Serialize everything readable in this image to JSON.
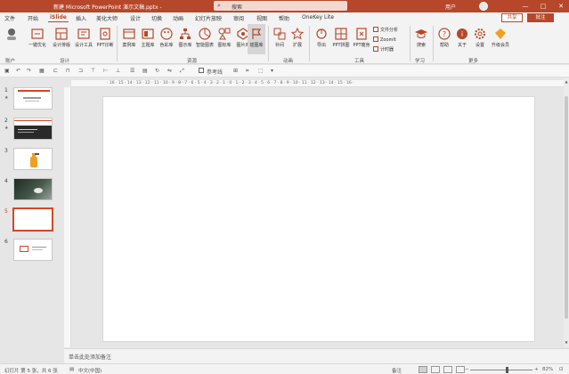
{
  "titlebar": {
    "title": "新建 Microsoft PowerPoint 演示文稿.pptx  -",
    "search_placeholder": "搜索",
    "user": "用户",
    "min": "—",
    "max": "□",
    "close": "✕"
  },
  "tabs": [
    "文件",
    "开始",
    "iSlide",
    "插入",
    "美化大师",
    "设计",
    "切换",
    "动画",
    "幻灯片放映",
    "审阅",
    "视图",
    "帮助",
    "OneKey Lite"
  ],
  "share": "共享",
  "comment": "批注",
  "ribbon": {
    "account": "账户",
    "one_key": "一键优化",
    "design_lib": "设计排版",
    "design_tools": "设计工具",
    "ppt_diag": "PPT诊断",
    "theme": "案例库",
    "color": "主题库",
    "color2": "色彩库",
    "icon": "图示库",
    "smart": "智能图表",
    "iconlib": "图标库",
    "pic": "图片库",
    "illus": "插图库",
    "fill": "补间",
    "expand": "扩展",
    "export": "导出",
    "ppt_split": "PPT拼图",
    "ppt_thin": "PPT瘦身",
    "file_analysis": "文件分析",
    "zoomit": "ZoomIt",
    "timer": "计时器",
    "learn": "搜索",
    "help": "帮助",
    "about": "关于",
    "settings": "设置",
    "upgrade": "升级会员",
    "group_design": "设计",
    "group_resource": "资源",
    "group_anim": "动画",
    "group_tools": "工具",
    "group_learn": "学习",
    "group_more": "更多"
  },
  "qab": {
    "ref_line": "参考线"
  },
  "hruler_text": "· 16 · 15 · 14 · 13 · 12 · 11 · 10 · 9 · 8 · 7 · 6 · 5 · 4 · 3 · 2 · 1 · 0 · 1 · 2 · 3 · 4 · 5 · 6 · 7 · 8 · 9 · 10 · 11 · 12 · 13 · 14 · 15 · 16 ·",
  "slides": [
    {
      "num": "1",
      "star": "★"
    },
    {
      "num": "2",
      "star": "★"
    },
    {
      "num": "3",
      "star": ""
    },
    {
      "num": "4",
      "star": ""
    },
    {
      "num": "5",
      "star": ""
    },
    {
      "num": "6",
      "star": ""
    }
  ],
  "notes_placeholder": "单击此处添加备注",
  "status": {
    "slide_info": "幻灯片 第 5 张，共 6 张",
    "lang": "中文(中国)",
    "notes": "备注",
    "zoom": "82%"
  },
  "colors": {
    "accent": "#b7472a"
  }
}
